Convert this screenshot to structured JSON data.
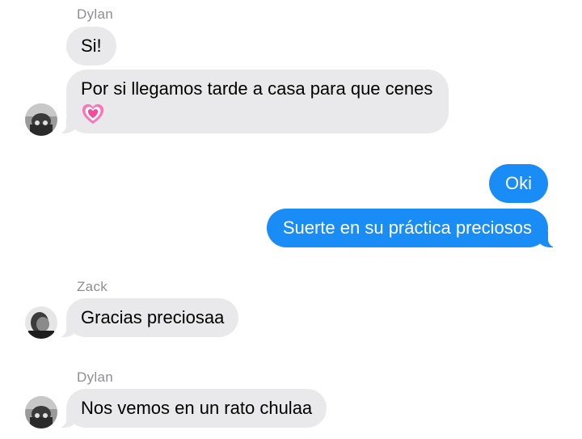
{
  "conversation": {
    "messages": [
      {
        "sender": "Dylan",
        "text": "Si!",
        "direction": "incoming"
      },
      {
        "sender": "Dylan",
        "text": "Por si llegamos tarde a casa para que cenes",
        "emoji": "heart-pulse-icon",
        "direction": "incoming"
      },
      {
        "sender": "me",
        "text": "Oki",
        "direction": "outgoing"
      },
      {
        "sender": "me",
        "text": "Suerte en su práctica preciosos",
        "direction": "outgoing"
      },
      {
        "sender": "Zack",
        "text": "Gracias preciosaa",
        "direction": "incoming"
      },
      {
        "sender": "Dylan",
        "text": "Nos vemos en un rato chulaa",
        "direction": "incoming"
      }
    ]
  },
  "senders": {
    "first": "Dylan",
    "second": "Zack",
    "third": "Dylan"
  },
  "colors": {
    "incoming_bubble": "#e9e9eb",
    "outgoing_bubble": "#1a8cf5",
    "sender_label": "#8e8e93"
  }
}
